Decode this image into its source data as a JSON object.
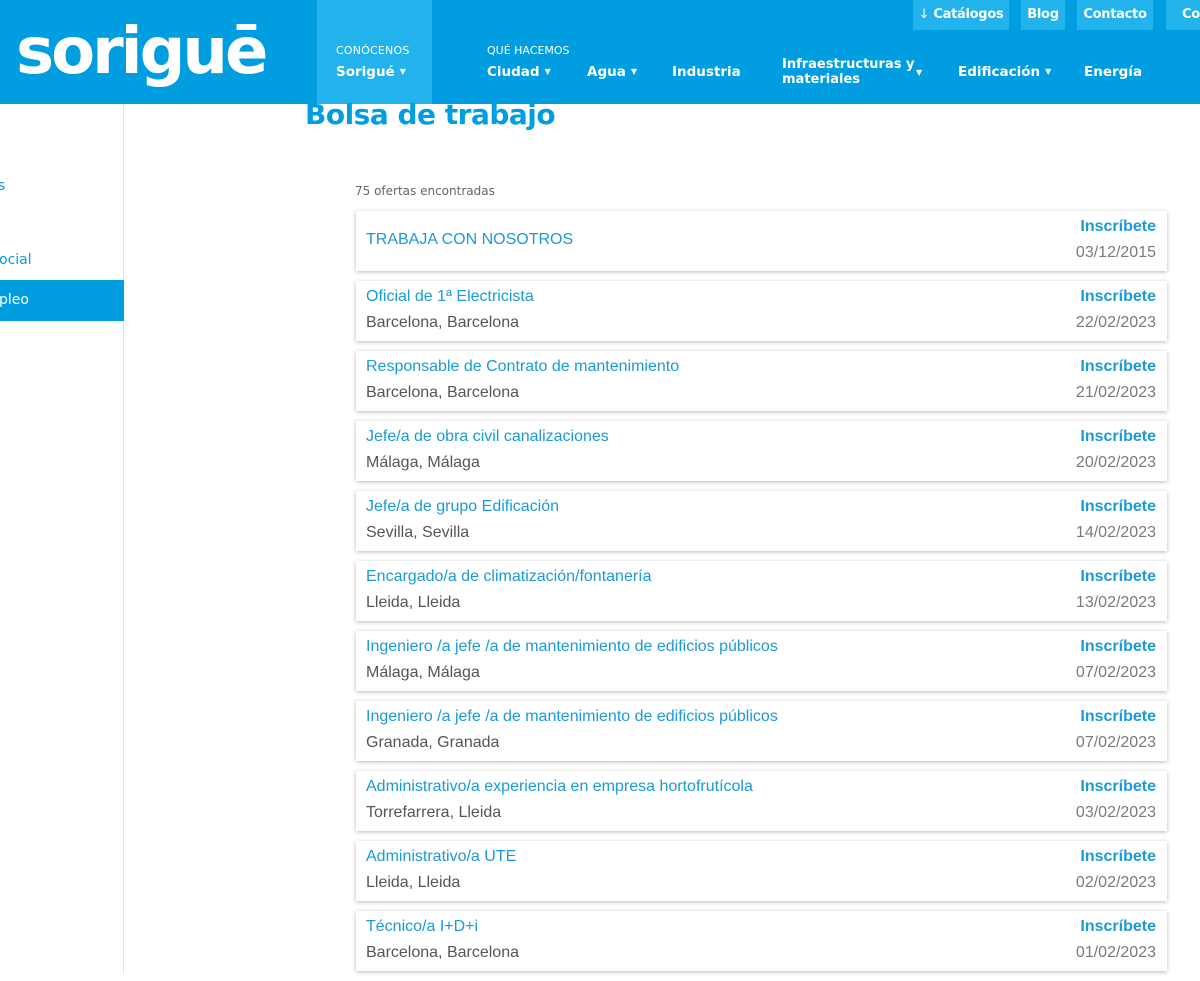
{
  "brand": {
    "logo": "soriguē"
  },
  "top_buttons": {
    "catalogos": "Catálogos",
    "download_icon": "arrow-down-icon",
    "blog": "Blog",
    "contacto": "Contacto",
    "partial": "Co"
  },
  "nav": {
    "conocenos_kicker": "CONÓCENOS",
    "sorigue": "Sorigué",
    "que_hacemos_kicker": "QUÉ HACEMOS",
    "ciudad": "Ciudad",
    "agua": "Agua",
    "industria": "Industria",
    "infraestructuras_line1": "Infraestructuras y",
    "infraestructuras_line2": "materiales",
    "edificacion": "Edificación",
    "energia": "Energía",
    "caret": "▼"
  },
  "sidebar": {
    "item_top": "s",
    "item_social": "ocial",
    "item_empleo": "pleo"
  },
  "page": {
    "title": "Bolsa de trabajo",
    "offers_count": "75 ofertas encontradas"
  },
  "jobs": [
    {
      "title": "TRABAJA CON NOSOTROS",
      "location": "",
      "apply": "Inscríbete",
      "date": "03/12/2015"
    },
    {
      "title": "Oficial de 1ª Electricista",
      "location": "Barcelona, Barcelona",
      "apply": "Inscríbete",
      "date": "22/02/2023"
    },
    {
      "title": "Responsable de Contrato de mantenimiento",
      "location": "Barcelona, Barcelona",
      "apply": "Inscríbete",
      "date": "21/02/2023"
    },
    {
      "title": "Jefe/a de obra civil canalizaciones",
      "location": "Málaga, Málaga",
      "apply": "Inscríbete",
      "date": "20/02/2023"
    },
    {
      "title": "Jefe/a de grupo Edificación",
      "location": "Sevilla, Sevilla",
      "apply": "Inscríbete",
      "date": "14/02/2023"
    },
    {
      "title": "Encargado/a de climatización/fontanería",
      "location": "Lleida, Lleida",
      "apply": "Inscríbete",
      "date": "13/02/2023"
    },
    {
      "title": "Ingeniero /a jefe /a de mantenimiento de edificios públicos",
      "location": "Málaga, Málaga",
      "apply": "Inscríbete",
      "date": "07/02/2023"
    },
    {
      "title": "Ingeniero /a jefe /a de mantenimiento de edificios públicos",
      "location": "Granada, Granada",
      "apply": "Inscríbete",
      "date": "07/02/2023"
    },
    {
      "title": "Administrativo/a experiencia en empresa hortofrutícola",
      "location": "Torrefarrera, Lleida",
      "apply": "Inscríbete",
      "date": "03/02/2023"
    },
    {
      "title": "Administrativo/a UTE",
      "location": "Lleida, Lleida",
      "apply": "Inscríbete",
      "date": "02/02/2023"
    },
    {
      "title": "Técnico/a I+D+i",
      "location": "Barcelona, Barcelona",
      "apply": "Inscríbete",
      "date": "01/02/2023"
    }
  ],
  "colors": {
    "brand_blue": "#009ee0",
    "nav_highlight": "#22b2ec",
    "link_blue": "#1a9ad6"
  }
}
